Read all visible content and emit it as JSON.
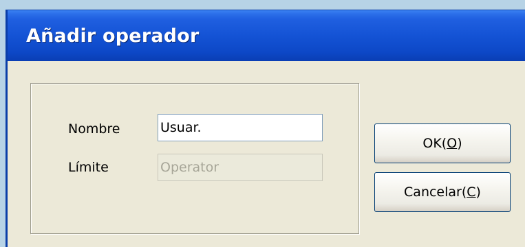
{
  "dialog": {
    "title": "Añadir operador"
  },
  "form": {
    "name_label": "Nombre",
    "name_value": "Usuar.",
    "limit_label": "Límite",
    "limit_value": "Operator"
  },
  "buttons": {
    "ok": {
      "prefix": "OK(",
      "mnemonic": "O",
      "suffix": ")"
    },
    "cancel": {
      "prefix": "Cancelar(",
      "mnemonic": "C",
      "suffix": ")"
    }
  },
  "colors": {
    "titlebar": "#0d48c7",
    "dialog_bg": "#ece9d8",
    "background": "#b7d3e6"
  }
}
